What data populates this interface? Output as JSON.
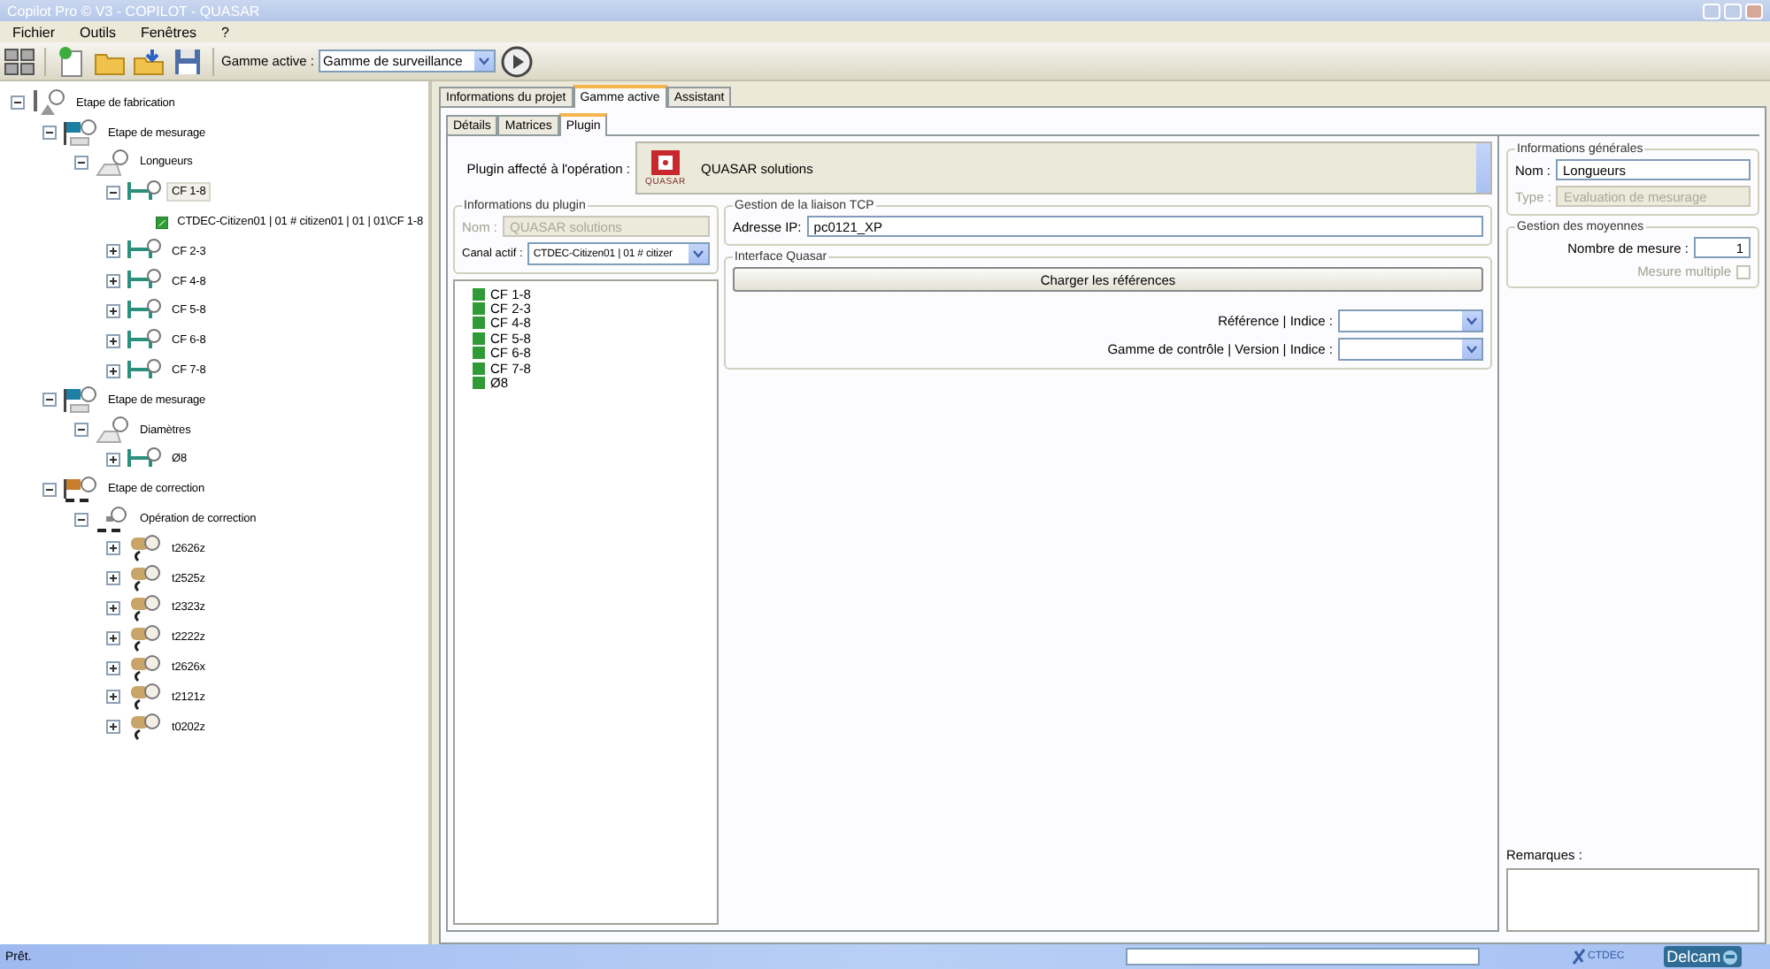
{
  "window": {
    "title": "Copilot Pro © V3 - COPILOT - QUASAR"
  },
  "menu": [
    "Fichier",
    "Outils",
    "Fenêtres",
    "?"
  ],
  "toolbar": {
    "active_range_label": "Gamme active :",
    "active_range": "Gamme de surveillance"
  },
  "tree": [
    {
      "label": "Etape de fabrication",
      "kind": "fabrication",
      "expanded": true,
      "selected": false,
      "children": [
        {
          "label": "Etape de mesurage",
          "kind": "measure-stage",
          "expanded": true,
          "selected": false,
          "children": [
            {
              "label": "Longueurs",
              "kind": "measure-op",
              "expanded": true,
              "selected": false,
              "children": [
                {
                  "label": "CF 1-8",
                  "kind": "dimension",
                  "expanded": true,
                  "selected": true,
                  "children": [
                    {
                      "label": "CTDEC-Citizen01 | 01 # citizen01 | 01 | 01\\CF 1-8",
                      "kind": "channel",
                      "selected": false
                    }
                  ]
                },
                {
                  "label": "CF 2-3",
                  "kind": "dimension",
                  "expanded": false,
                  "selected": false
                },
                {
                  "label": "CF 4-8",
                  "kind": "dimension",
                  "expanded": false,
                  "selected": false
                },
                {
                  "label": "CF 5-8",
                  "kind": "dimension",
                  "expanded": false,
                  "selected": false
                },
                {
                  "label": "CF 6-8",
                  "kind": "dimension",
                  "expanded": false,
                  "selected": false
                },
                {
                  "label": "CF 7-8",
                  "kind": "dimension",
                  "expanded": false,
                  "selected": false
                }
              ]
            }
          ]
        },
        {
          "label": "Etape de mesurage",
          "kind": "measure-stage",
          "expanded": true,
          "selected": false,
          "children": [
            {
              "label": "Diamètres",
              "kind": "measure-op",
              "expanded": true,
              "selected": false,
              "children": [
                {
                  "label": "Ø8",
                  "kind": "dimension",
                  "expanded": false,
                  "selected": false
                }
              ]
            }
          ]
        },
        {
          "label": "Etape de correction",
          "kind": "correction-stage",
          "expanded": true,
          "selected": false,
          "children": [
            {
              "label": "Opération de correction",
              "kind": "correction-op",
              "expanded": true,
              "selected": false,
              "children": [
                {
                  "label": "t2626z",
                  "kind": "tool",
                  "expanded": false,
                  "selected": false
                },
                {
                  "label": "t2525z",
                  "kind": "tool",
                  "expanded": false,
                  "selected": false
                },
                {
                  "label": "t2323z",
                  "kind": "tool",
                  "expanded": false,
                  "selected": false
                },
                {
                  "label": "t2222z",
                  "kind": "tool",
                  "expanded": false,
                  "selected": false
                },
                {
                  "label": "t2626x",
                  "kind": "tool",
                  "expanded": false,
                  "selected": false
                },
                {
                  "label": "t2121z",
                  "kind": "tool",
                  "expanded": false,
                  "selected": false
                },
                {
                  "label": "t0202z",
                  "kind": "tool",
                  "expanded": false,
                  "selected": false
                }
              ]
            }
          ]
        }
      ]
    }
  ],
  "tabs": [
    {
      "label": "Informations du projet",
      "selected": false
    },
    {
      "label": "Gamme active",
      "selected": true
    },
    {
      "label": "Assistant",
      "selected": false
    }
  ],
  "subtabs": [
    {
      "label": "Détails",
      "selected": false
    },
    {
      "label": "Matrices",
      "selected": false
    },
    {
      "label": "Plugin",
      "selected": true
    }
  ],
  "plugin": {
    "label": "Plugin affecté à l'opération :",
    "logo_text": "QUASAR",
    "name": "QUASAR solutions"
  },
  "plugin_info": {
    "title": "Informations du plugin",
    "name_label": "Nom :",
    "name_value": "QUASAR solutions",
    "name_disabled": true,
    "channel_label": "Canal actif :",
    "channel_value": "CTDEC-Citizen01 | 01 # citizer"
  },
  "channel_list": [
    "CF 1-8",
    "CF 2-3",
    "CF 4-8",
    "CF 5-8",
    "CF 6-8",
    "CF 7-8",
    "Ø8"
  ],
  "tcp": {
    "title": "Gestion de la liaison TCP",
    "ip_label": "Adresse IP:",
    "ip_value": "pc0121_XP"
  },
  "quasar": {
    "title": "Interface Quasar",
    "load_button": "Charger les références",
    "reference_label": "Référence | Indice :",
    "range_label": "Gamme de contrôle | Version | Indice :"
  },
  "general": {
    "title": "Informations générales",
    "name_label": "Nom :",
    "name_value": "Longueurs",
    "type_label": "Type :",
    "type_value": "Evaluation de mesurage",
    "type_disabled": true
  },
  "averages": {
    "title": "Gestion des moyennes",
    "count_label": "Nombre de mesure :",
    "count_value": "1",
    "multiple_label": "Mesure multiple",
    "multiple_checked": false
  },
  "remarks": {
    "label": "Remarques :"
  },
  "status_bar": {
    "text": "Prêt.",
    "progress": {
      "level": 0
    },
    "logos": [
      "CTDEC",
      "Delcam"
    ]
  }
}
